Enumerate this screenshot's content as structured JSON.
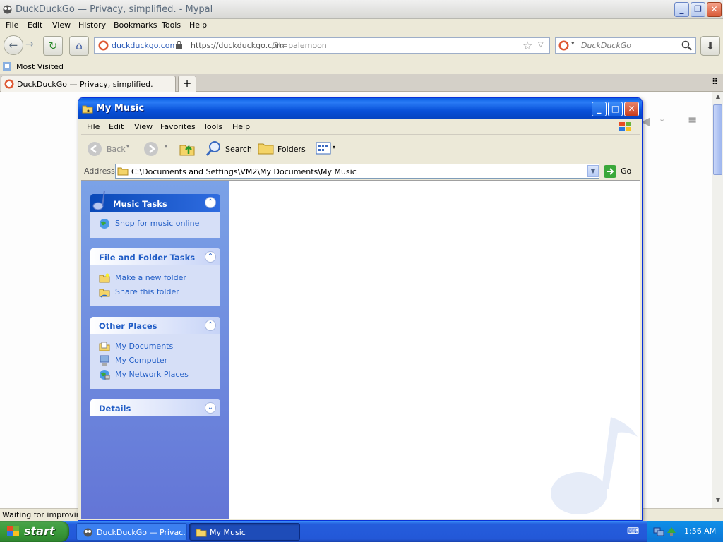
{
  "browser": {
    "title": "DuckDuckGo — Privacy, simplified. - Mypal",
    "menu": [
      "File",
      "Edit",
      "View",
      "History",
      "Bookmarks",
      "Tools",
      "Help"
    ],
    "site_identity": "duckduckgo.com",
    "url_host": "https://duckduckgo.com",
    "url_rest": "/?t=palemoon",
    "search_engine_placeholder": "DuckDuckGo",
    "bookmark": "Most Visited",
    "tab_title": "DuckDuckGo — Privacy, simplified.",
    "status": "Waiting for improving..."
  },
  "explorer": {
    "title": "My Music",
    "menu": [
      "File",
      "Edit",
      "View",
      "Favorites",
      "Tools",
      "Help"
    ],
    "toolbar": {
      "back": "Back",
      "search": "Search",
      "folders": "Folders"
    },
    "address_label": "Address",
    "address_value": "C:\\Documents and Settings\\VM2\\My Documents\\My Music",
    "go_label": "Go",
    "panels": {
      "music_tasks": {
        "title": "Music Tasks",
        "items": [
          "Shop for music online"
        ]
      },
      "file_folder_tasks": {
        "title": "File and Folder Tasks",
        "items": [
          "Make a new folder",
          "Share this folder"
        ]
      },
      "other_places": {
        "title": "Other Places",
        "items": [
          "My Documents",
          "My Computer",
          "My Network Places"
        ]
      },
      "details": {
        "title": "Details"
      }
    }
  },
  "taskbar": {
    "start": "start",
    "items": [
      "DuckDuckGo — Privac...",
      "My Music"
    ],
    "clock": "1:56 AM"
  },
  "colors": {
    "xp_blue": "#0a5fe2",
    "task_link": "#215dc6",
    "start_green": "#3a9a3a"
  }
}
